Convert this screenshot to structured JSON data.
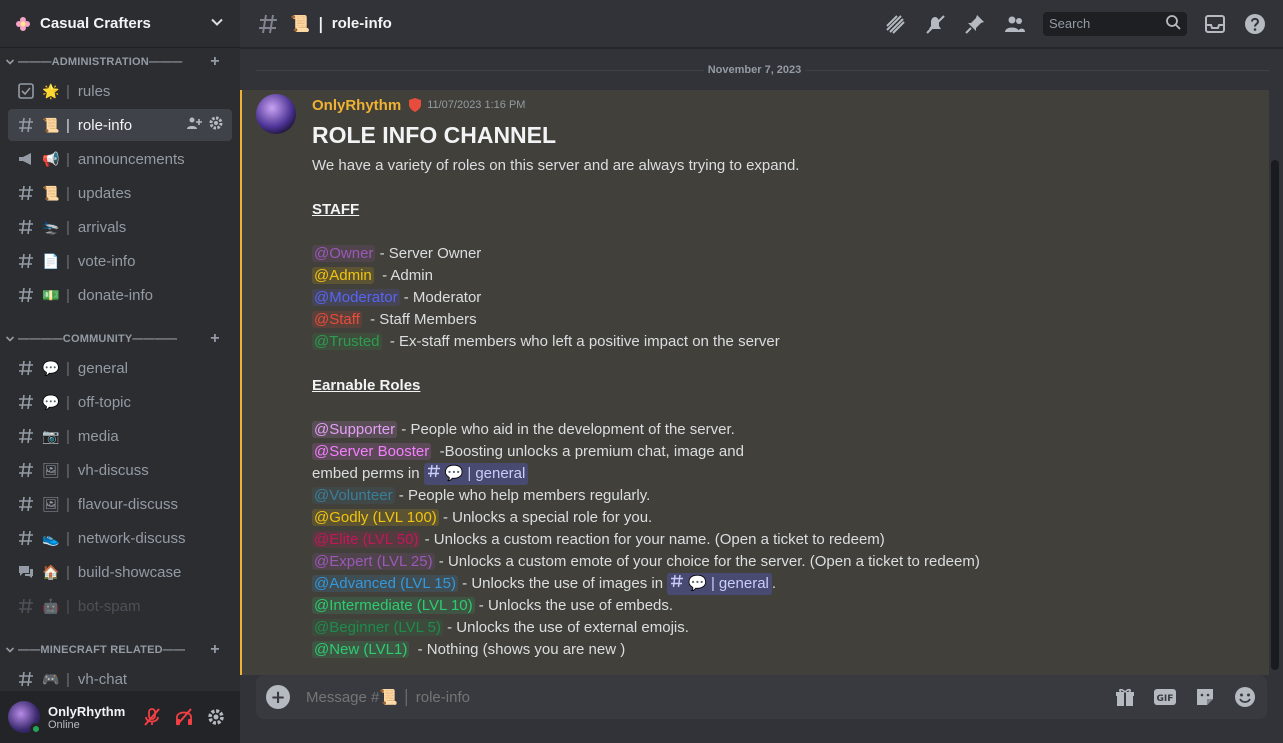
{
  "guild": {
    "name": "Casual Crafters"
  },
  "sidebar": {
    "categories": [
      {
        "name": "———ADMINISTRATION———",
        "channels": [
          {
            "label": "rules",
            "emoji": "🌟",
            "sep": "|"
          },
          {
            "label": "role-info",
            "emoji": "📜",
            "sep": "|"
          },
          {
            "label": "announcements",
            "emoji": "📢",
            "sep": "|"
          },
          {
            "label": "updates",
            "emoji": "📜",
            "sep": "|"
          },
          {
            "label": "arrivals",
            "emoji": "🛬",
            "sep": "|"
          },
          {
            "label": "vote-info",
            "emoji": "📄",
            "sep": "|"
          },
          {
            "label": "donate-info",
            "emoji": "💵",
            "sep": "|"
          }
        ]
      },
      {
        "name": "————COMMUNITY————",
        "channels": [
          {
            "label": "general",
            "emoji": "💬",
            "sep": "|"
          },
          {
            "label": "off-topic",
            "emoji": "💬",
            "sep": "|"
          },
          {
            "label": "media",
            "emoji": "📷",
            "sep": "|"
          },
          {
            "label": "vh-discuss",
            "emoji": "🖼",
            "sep": "|"
          },
          {
            "label": "flavour-discuss",
            "emoji": "🖼",
            "sep": "|"
          },
          {
            "label": "network-discuss",
            "emoji": "👟",
            "sep": "|"
          },
          {
            "label": "build-showcase",
            "emoji": "🏠",
            "sep": "|"
          },
          {
            "label": "bot-spam",
            "emoji": "🤖",
            "sep": "|"
          }
        ]
      },
      {
        "name": "——MINECRAFT RELATED——",
        "channels": [
          {
            "label": "vh-chat",
            "emoji": "🎮",
            "sep": "|"
          }
        ]
      }
    ]
  },
  "user": {
    "name": "OnlyRhythm",
    "status": "Online"
  },
  "header": {
    "channel_emoji": "📜",
    "sep": "|",
    "title": "role-info",
    "search_placeholder": "Search"
  },
  "divider": {
    "date": "November 7, 2023"
  },
  "message": {
    "author": "OnlyRhythm",
    "timestamp": "11/07/2023 1:16 PM",
    "title": "ROLE INFO CHANNEL",
    "intro": "We have a variety of roles on this server and are always trying to expand.",
    "staff_heading": "STAFF",
    "staff": [
      {
        "role": "@Owner",
        "desc": " - Server Owner",
        "color": "#9b59b6",
        "bg": "rgba(155,89,182,.15)"
      },
      {
        "role": "@Admin",
        "desc": "  - Admin",
        "color": "#f1c40f",
        "bg": "rgba(241,196,15,.15)"
      },
      {
        "role": "@Moderator",
        "desc": " - Moderator",
        "color": "#5865f2",
        "bg": "rgba(88,101,242,.15)"
      },
      {
        "role": "@Staff",
        "desc": "  - Staff Members",
        "color": "#e74c3c",
        "bg": "rgba(231,76,60,.15)"
      },
      {
        "role": "@Trusted",
        "desc": "  - Ex-staff members who left a positive impact on the server",
        "color": "#2d9c4f",
        "bg": "rgba(45,156,79,.15)"
      }
    ],
    "earnable_heading": "Earnable Roles",
    "earnable": [
      {
        "role": "@Supporter",
        "desc": " - People who aid in the development of the server.",
        "color": "#e39ff6",
        "bg": "rgba(227,159,246,.15)"
      },
      {
        "role": "@Server Booster",
        "desc": "  -Boosting unlocks a premium chat, image and",
        "color": "#f47fff",
        "bg": "rgba(244,127,255,.15)"
      },
      {
        "role": "@Volunteer",
        "desc": " - People who help members regularly.",
        "color": "#3b7e9a",
        "bg": "rgba(59,126,154,.15)"
      },
      {
        "role": "@Godly (LVL 100)",
        "desc": " - Unlocks a special role for you.",
        "color": "#f1c40f",
        "bg": "rgba(241,196,15,.15)"
      },
      {
        "role": "@Elite (LVL 50)",
        "desc": " - Unlocks a custom reaction for your name. (Open a ticket to redeem)",
        "color": "#c2185b",
        "bg": "rgba(194,24,91,.15)"
      },
      {
        "role": "@Expert (LVL 25)",
        "desc": " - Unlocks a custom emote of your choice for the server. (Open a ticket to redeem)",
        "color": "#9b59b6",
        "bg": "rgba(155,89,182,.15)"
      },
      {
        "role": "@Advanced (LVL 15)",
        "desc": " - Unlocks the use of images in ",
        "color": "#3498db",
        "bg": "rgba(52,152,219,.15)"
      },
      {
        "role": "@Intermediate (LVL 10)",
        "desc": " - Unlocks the use of embeds.",
        "color": "#2ecc71",
        "bg": "rgba(46,204,113,.15)"
      },
      {
        "role": "@Beginner (LVL 5)",
        "desc": " - Unlocks the use of external emojis.",
        "color": "#1f8b4c",
        "bg": "rgba(31,139,76,.15)"
      },
      {
        "role": "@New (LVL1)",
        "desc": "  - Nothing (shows you are new )",
        "color": "#2ecc71",
        "bg": "rgba(46,204,113,.15)"
      }
    ],
    "booster_cont": "embed perms in ",
    "channel_mention": {
      "emoji": "💬",
      "sep": "|",
      "name": "general"
    },
    "advanced_tail": "."
  },
  "composer": {
    "placeholder": "Message #📜 │ role-info"
  },
  "icons": [
    "hashtag-icon",
    "threads-icon",
    "bell-muted-icon",
    "pin-icon",
    "members-icon",
    "search-icon",
    "inbox-icon",
    "help-icon",
    "gift-icon",
    "gif-icon",
    "sticker-icon",
    "emoji-icon",
    "mic-muted-icon",
    "headphones-muted-icon",
    "gear-icon"
  ]
}
